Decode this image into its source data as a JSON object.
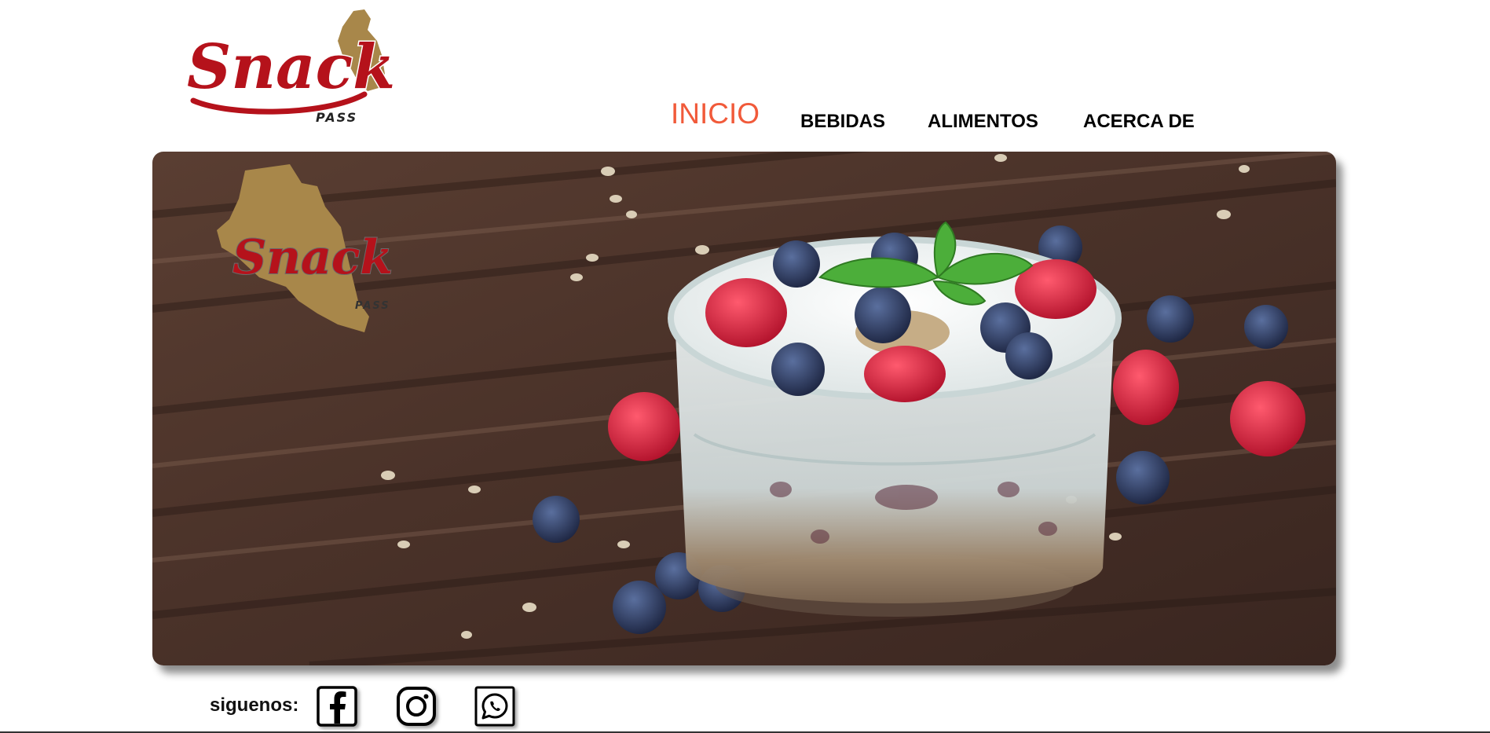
{
  "brand": {
    "logo_wordmark": "Snack",
    "logo_sub": "PASS"
  },
  "nav": {
    "items": [
      {
        "label": "INICIO",
        "active": true
      },
      {
        "label": "BEBIDAS",
        "active": false
      },
      {
        "label": "ALIMENTOS",
        "active": false
      },
      {
        "label": "ACERCA DE",
        "active": false
      }
    ],
    "active_color": "#f15a3a"
  },
  "hero": {
    "overlay_wordmark": "Snack",
    "overlay_sub": "PASS",
    "image_subject": "yogurt parfait with raspberries, blueberries and mint on wooden table"
  },
  "footer": {
    "follow_label": "siguenos:",
    "social": [
      {
        "name": "facebook",
        "icon": "facebook-icon"
      },
      {
        "name": "instagram",
        "icon": "instagram-icon"
      },
      {
        "name": "whatsapp",
        "icon": "whatsapp-icon"
      }
    ]
  },
  "colors": {
    "brand_red": "#b5121b",
    "brand_gold": "#a8874a"
  }
}
